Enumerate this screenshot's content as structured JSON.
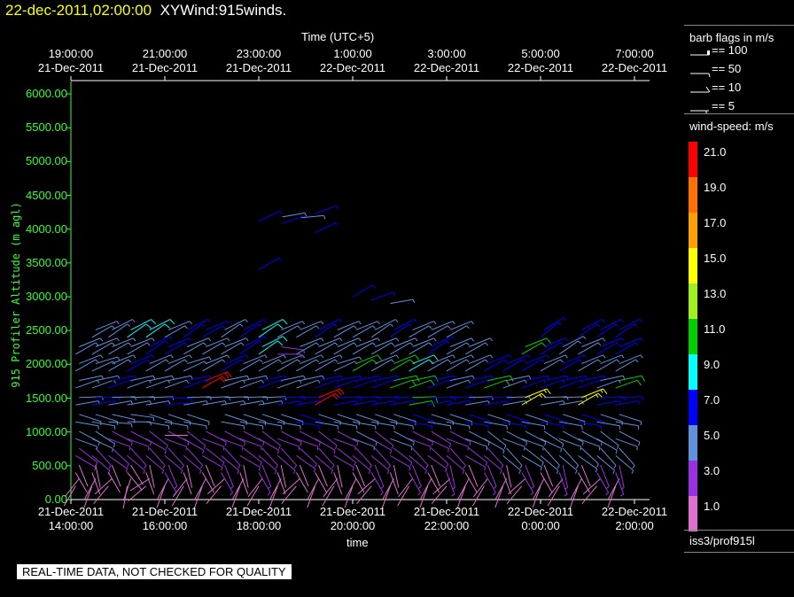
{
  "header": {
    "date": "22-dec-2011,02:00:00",
    "title": "XYWind:915winds."
  },
  "footer": {
    "quality": "REAL-TIME DATA, NOT CHECKED FOR QUALITY",
    "source": "iss3/prof915l"
  },
  "legend": {
    "barb_title": "barb flags in m/s",
    "barbs": [
      "== 100",
      "== 50",
      "== 10",
      "== 5"
    ],
    "speed_title": "wind-speed: m/s",
    "colorbar": [
      {
        "label": "21.0",
        "color": "#ff0000"
      },
      {
        "label": "19.0",
        "color": "#ff7000"
      },
      {
        "label": "17.0",
        "color": "#ffa000"
      },
      {
        "label": "15.0",
        "color": "#ffff00"
      },
      {
        "label": "13.0",
        "color": "#a0f020"
      },
      {
        "label": "11.0",
        "color": "#00d000"
      },
      {
        "label": "9.0",
        "color": "#00ffff"
      },
      {
        "label": "7.0",
        "color": "#0000ff"
      },
      {
        "label": "5.0",
        "color": "#6090e0"
      },
      {
        "label": "3.0",
        "color": "#9a30e0"
      },
      {
        "label": "1.0",
        "color": "#e070d0"
      }
    ]
  },
  "chart_data": {
    "type": "wind-barb",
    "title": "XYWind:915winds.",
    "xlabel": "time",
    "x2label": "Time (UTC+5)",
    "ylabel": "915 Profiler Altitude (m agl)",
    "ylim": [
      0,
      6000
    ],
    "xlim_hours": [
      14,
      26.3
    ],
    "yticks": [
      "0.00",
      "500.00",
      "1000.00",
      "1500.00",
      "2000.00",
      "2500.00",
      "3000.00",
      "3500.00",
      "4000.00",
      "4500.00",
      "5000.00",
      "5500.00",
      "6000.00"
    ],
    "xticks_bottom": [
      [
        "21-Dec-2011",
        "14:00:00"
      ],
      [
        "21-Dec-2011",
        "16:00:00"
      ],
      [
        "21-Dec-2011",
        "18:00:00"
      ],
      [
        "21-Dec-2011",
        "20:00:00"
      ],
      [
        "21-Dec-2011",
        "22:00:00"
      ],
      [
        "22-Dec-2011",
        "0:00:00"
      ],
      [
        "22-Dec-2011",
        "2:00:00"
      ]
    ],
    "xticks_top": [
      [
        "19:00:00",
        "21-Dec-2011"
      ],
      [
        "21:00:00",
        "21-Dec-2011"
      ],
      [
        "23:00:00",
        "21-Dec-2011"
      ],
      [
        "1:00:00",
        "22-Dec-2011"
      ],
      [
        "3:00:00",
        "22-Dec-2011"
      ],
      [
        "5:00:00",
        "22-Dec-2011"
      ],
      [
        "7:00:00",
        "22-Dec-2011"
      ]
    ],
    "levels_m": [
      200,
      400,
      650,
      900,
      1150,
      1400,
      1650,
      1900,
      2150,
      2400
    ],
    "profiles": [
      {
        "t": 14.1,
        "s": [
          2,
          1,
          3,
          5,
          6,
          5,
          6,
          6,
          5,
          null
        ],
        "d": [
          210,
          150,
          120,
          110,
          100,
          80,
          70,
          60,
          60,
          60
        ]
      },
      {
        "t": 14.45,
        "s": [
          2,
          2,
          3,
          5,
          5,
          7,
          6,
          5,
          5,
          6
        ],
        "d": [
          200,
          160,
          130,
          115,
          100,
          80,
          70,
          65,
          60,
          60
        ]
      },
      {
        "t": 14.8,
        "s": [
          1,
          2,
          3,
          4,
          5,
          6,
          7,
          6,
          5,
          5
        ],
        "d": [
          220,
          150,
          125,
          110,
          95,
          80,
          70,
          60,
          60,
          55
        ]
      },
      {
        "t": 15.2,
        "s": [
          2,
          2,
          3,
          3,
          5,
          6,
          6,
          7,
          6,
          9
        ],
        "d": [
          190,
          140,
          130,
          110,
          90,
          80,
          70,
          60,
          60,
          55
        ]
      },
      {
        "t": 15.6,
        "s": [
          1,
          2,
          3,
          4,
          5,
          6,
          6,
          5,
          7,
          9
        ],
        "d": [
          230,
          160,
          130,
          120,
          100,
          80,
          70,
          60,
          55,
          55
        ]
      },
      {
        "t": 16.0,
        "s": [
          2,
          3,
          3,
          4,
          5,
          7,
          6,
          6,
          7,
          5
        ],
        "d": [
          200,
          150,
          130,
          110,
          100,
          85,
          70,
          60,
          60,
          60
        ]
      },
      {
        "t": 16.4,
        "s": [
          1,
          2,
          3,
          3,
          5,
          6,
          7,
          5,
          6,
          7
        ],
        "d": [
          210,
          160,
          130,
          120,
          100,
          80,
          70,
          65,
          60,
          55
        ]
      },
      {
        "t": 16.8,
        "s": [
          2,
          2,
          3,
          3,
          null,
          5,
          21,
          6,
          5,
          7
        ],
        "d": [
          200,
          150,
          120,
          110,
          100,
          80,
          60,
          60,
          60,
          60
        ]
      },
      {
        "t": 17.2,
        "s": [
          1,
          3,
          3,
          4,
          5,
          6,
          5,
          7,
          6,
          5
        ],
        "d": [
          220,
          150,
          130,
          110,
          100,
          80,
          70,
          60,
          60,
          55
        ]
      },
      {
        "t": 17.6,
        "s": [
          2,
          2,
          3,
          3,
          5,
          6,
          6,
          5,
          7,
          7
        ],
        "d": [
          200,
          160,
          120,
          110,
          100,
          80,
          70,
          60,
          55,
          55
        ]
      },
      {
        "t": 18.0,
        "s": [
          2,
          3,
          3,
          3,
          5,
          5,
          7,
          6,
          9,
          9
        ],
        "d": [
          210,
          150,
          130,
          120,
          100,
          80,
          70,
          60,
          55,
          55
        ]
      },
      {
        "t": 18.4,
        "s": [
          1,
          2,
          3,
          3,
          5,
          7,
          6,
          6,
          3,
          5
        ],
        "d": [
          200,
          160,
          130,
          110,
          100,
          80,
          70,
          60,
          90,
          60
        ]
      },
      {
        "t": 18.8,
        "s": [
          2,
          2,
          3,
          3,
          7,
          7,
          6,
          5,
          6,
          5
        ],
        "d": [
          220,
          150,
          125,
          110,
          100,
          80,
          70,
          60,
          60,
          60
        ]
      },
      {
        "t": 19.2,
        "s": [
          1,
          2,
          3,
          3,
          5,
          21,
          7,
          6,
          5,
          7
        ],
        "d": [
          200,
          150,
          130,
          120,
          100,
          60,
          70,
          60,
          60,
          55
        ]
      },
      {
        "t": 19.6,
        "s": [
          2,
          1,
          3,
          3,
          5,
          7,
          7,
          5,
          6,
          5
        ],
        "d": [
          210,
          160,
          120,
          110,
          100,
          80,
          70,
          65,
          60,
          60
        ]
      },
      {
        "t": 20.0,
        "s": [
          1,
          2,
          3,
          5,
          5,
          7,
          7,
          11,
          6,
          5
        ],
        "d": [
          200,
          150,
          130,
          110,
          100,
          80,
          70,
          60,
          60,
          60
        ]
      },
      {
        "t": 20.4,
        "s": [
          2,
          3,
          3,
          3,
          5,
          7,
          7,
          6,
          6,
          5
        ],
        "d": [
          220,
          150,
          130,
          120,
          100,
          80,
          70,
          60,
          60,
          55
        ]
      },
      {
        "t": 20.8,
        "s": [
          1,
          2,
          3,
          5,
          5,
          7,
          11,
          11,
          6,
          7
        ],
        "d": [
          200,
          160,
          120,
          110,
          100,
          80,
          70,
          60,
          60,
          55
        ]
      },
      {
        "t": 21.2,
        "s": [
          2,
          3,
          3,
          3,
          7,
          11,
          11,
          9,
          6,
          5
        ],
        "d": [
          210,
          150,
          130,
          110,
          100,
          80,
          70,
          60,
          60,
          60
        ]
      },
      {
        "t": 21.6,
        "s": [
          2,
          2,
          3,
          3,
          5,
          7,
          7,
          6,
          7,
          5
        ],
        "d": [
          200,
          150,
          125,
          115,
          100,
          80,
          70,
          60,
          55,
          60
        ]
      },
      {
        "t": 22.0,
        "s": [
          1,
          3,
          3,
          3,
          5,
          7,
          6,
          5,
          6,
          5
        ],
        "d": [
          220,
          160,
          130,
          110,
          100,
          80,
          70,
          60,
          60,
          60
        ]
      },
      {
        "t": 22.4,
        "s": [
          2,
          2,
          3,
          5,
          7,
          5,
          7,
          6,
          5,
          null
        ],
        "d": [
          200,
          150,
          120,
          110,
          100,
          80,
          70,
          60,
          60,
          60
        ]
      },
      {
        "t": 22.8,
        "s": [
          2,
          3,
          3,
          5,
          5,
          7,
          11,
          7,
          null,
          null
        ],
        "d": [
          210,
          150,
          130,
          120,
          100,
          80,
          70,
          60,
          60,
          60
        ]
      },
      {
        "t": 23.2,
        "s": [
          1,
          2,
          5,
          5,
          7,
          6,
          6,
          7,
          null,
          null
        ],
        "d": [
          200,
          160,
          130,
          110,
          100,
          80,
          70,
          60,
          60,
          60
        ]
      },
      {
        "t": 23.6,
        "s": [
          2,
          3,
          5,
          5,
          5,
          15,
          7,
          7,
          11,
          null
        ],
        "d": [
          220,
          150,
          120,
          110,
          100,
          60,
          70,
          60,
          60,
          60
        ]
      },
      {
        "t": 24.0,
        "s": [
          1,
          2,
          5,
          5,
          7,
          6,
          7,
          5,
          7,
          7
        ],
        "d": [
          200,
          150,
          130,
          115,
          100,
          80,
          70,
          60,
          60,
          50
        ]
      },
      {
        "t": 24.4,
        "s": [
          2,
          3,
          5,
          5,
          5,
          6,
          7,
          7,
          6,
          null
        ],
        "d": [
          210,
          160,
          130,
          110,
          100,
          80,
          70,
          60,
          55,
          60
        ]
      },
      {
        "t": 24.8,
        "s": [
          1,
          2,
          5,
          5,
          7,
          15,
          7,
          6,
          5,
          7
        ],
        "d": [
          200,
          150,
          125,
          110,
          100,
          60,
          70,
          60,
          60,
          55
        ]
      },
      {
        "t": 25.2,
        "s": [
          2,
          3,
          5,
          5,
          5,
          7,
          5,
          6,
          7,
          7
        ],
        "d": [
          220,
          150,
          130,
          120,
          100,
          80,
          70,
          60,
          60,
          55
        ]
      },
      {
        "t": 25.6,
        "s": [
          1,
          3,
          5,
          5,
          5,
          7,
          11,
          6,
          7,
          7
        ],
        "d": [
          200,
          160,
          130,
          110,
          100,
          80,
          70,
          60,
          60,
          55
        ]
      }
    ],
    "extra_points": [
      [
        18.0,
        3400,
        7,
        60
      ],
      [
        18.0,
        4120,
        7,
        65
      ],
      [
        18.5,
        4180,
        5,
        80
      ],
      [
        18.5,
        4080,
        7,
        70
      ],
      [
        18.9,
        4170,
        5,
        85
      ],
      [
        19.2,
        4230,
        7,
        70
      ],
      [
        19.2,
        3950,
        7,
        65
      ],
      [
        20.0,
        3000,
        7,
        60
      ],
      [
        20.4,
        2950,
        7,
        70
      ],
      [
        20.8,
        2900,
        5,
        80
      ],
      [
        16.0,
        950,
        1,
        90
      ]
    ]
  }
}
